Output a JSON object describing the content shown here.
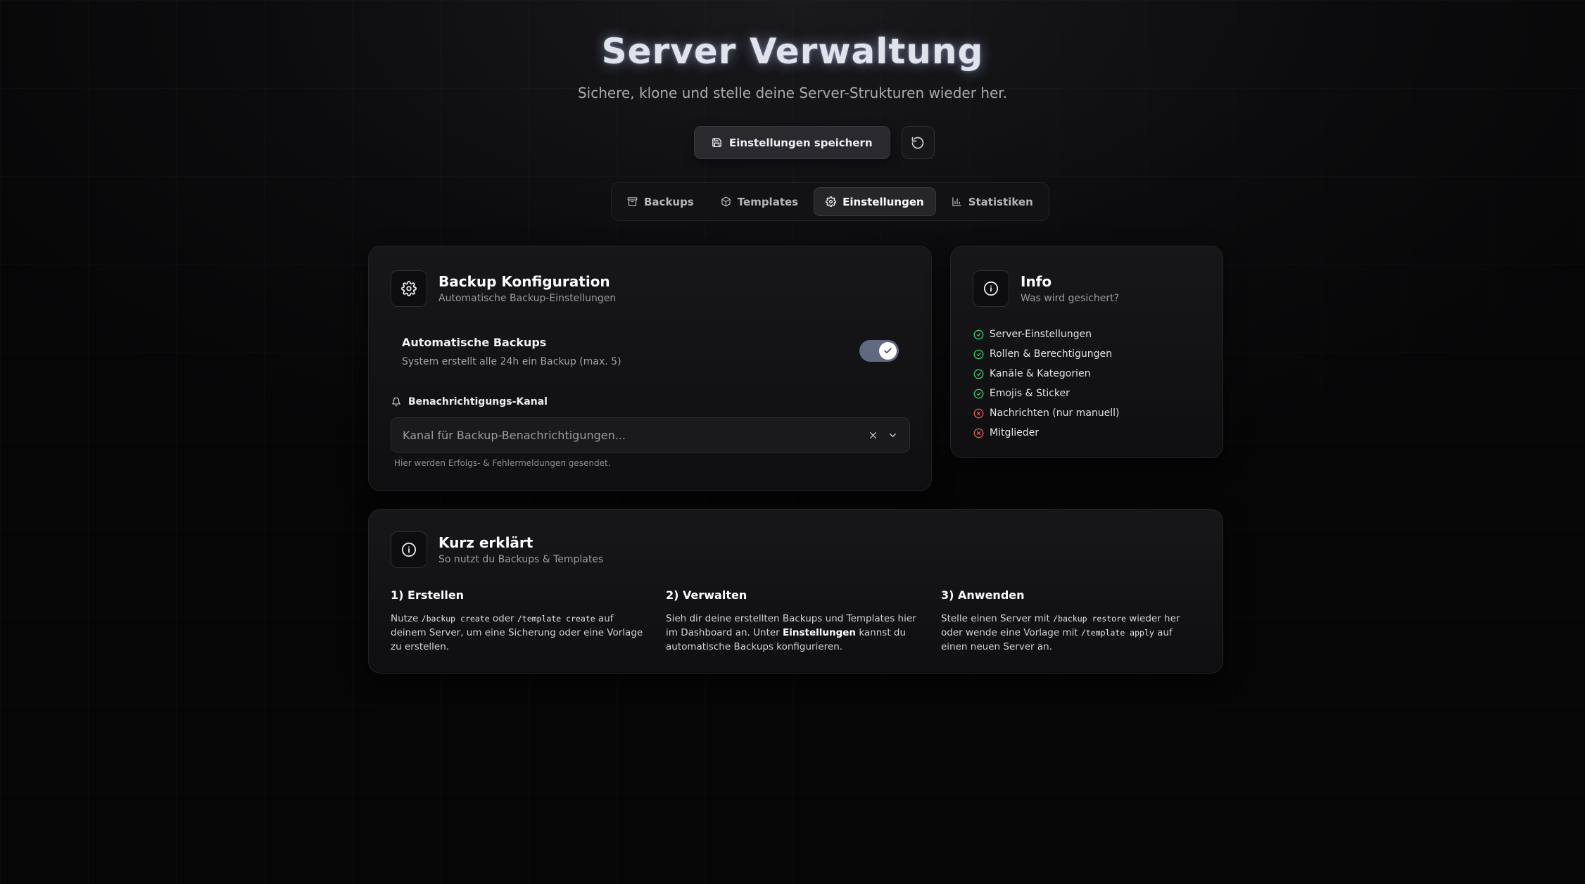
{
  "hero": {
    "title": "Server Verwaltung",
    "subtitle": "Sichere, klone und stelle deine Server-Strukturen wieder her."
  },
  "actions": {
    "save_label": "Einstellungen speichern",
    "save_icon": "save-icon",
    "reset_icon": "refresh-icon"
  },
  "tabs": [
    {
      "label": "Backups",
      "icon": "archive-icon",
      "active": false
    },
    {
      "label": "Templates",
      "icon": "package-icon",
      "active": false
    },
    {
      "label": "Einstellungen",
      "icon": "gear-icon",
      "active": true
    },
    {
      "label": "Statistiken",
      "icon": "bar-chart-icon",
      "active": false
    }
  ],
  "config": {
    "title": "Backup Konfiguration",
    "subtitle": "Automatische Backup-Einstellungen",
    "auto_title": "Automatische Backups",
    "auto_sub": "System erstellt alle 24h ein Backup (max. 5)",
    "auto_enabled": true,
    "notify_label": "Benachrichtigungs-Kanal",
    "select_placeholder": "Kanal für Backup-Benachrichtigungen...",
    "hint": "Hier werden Erfolgs- & Fehlermeldungen gesendet."
  },
  "info": {
    "title": "Info",
    "subtitle": "Was wird gesichert?",
    "items": [
      {
        "label": "Server-Einstellungen",
        "included": true
      },
      {
        "label": "Rollen & Berechtigungen",
        "included": true
      },
      {
        "label": "Kanäle & Kategorien",
        "included": true
      },
      {
        "label": "Emojis & Sticker",
        "included": true
      },
      {
        "label": "Nachrichten (nur manuell)",
        "included": false
      },
      {
        "label": "Mitglieder",
        "included": false
      }
    ],
    "colors": {
      "included": "#3fc26b",
      "excluded": "#e05555"
    }
  },
  "explain": {
    "title": "Kurz erklärt",
    "subtitle": "So nutzt du Backups & Templates",
    "step1": {
      "title": "1) Erstellen",
      "t1": "Nutze ",
      "c1": "/backup create",
      "t2": " oder ",
      "c2": "/template create",
      "t3": " auf deinem Server, um eine Sicherung oder eine Vorlage zu erstellen."
    },
    "step2": {
      "title": "2) Verwalten",
      "t1": "Sieh dir deine erstellten Backups und Templates hier im Dashboard an. Unter ",
      "b1": "Einstellungen",
      "t2": " kannst du automatische Backups konfigurieren."
    },
    "step3": {
      "title": "3) Anwenden",
      "t1": "Stelle einen Server mit ",
      "c1": "/backup restore",
      "t2": " wieder her oder wende eine Vorlage mit ",
      "c2": "/template apply",
      "t3": " auf einen neuen Server an."
    }
  }
}
